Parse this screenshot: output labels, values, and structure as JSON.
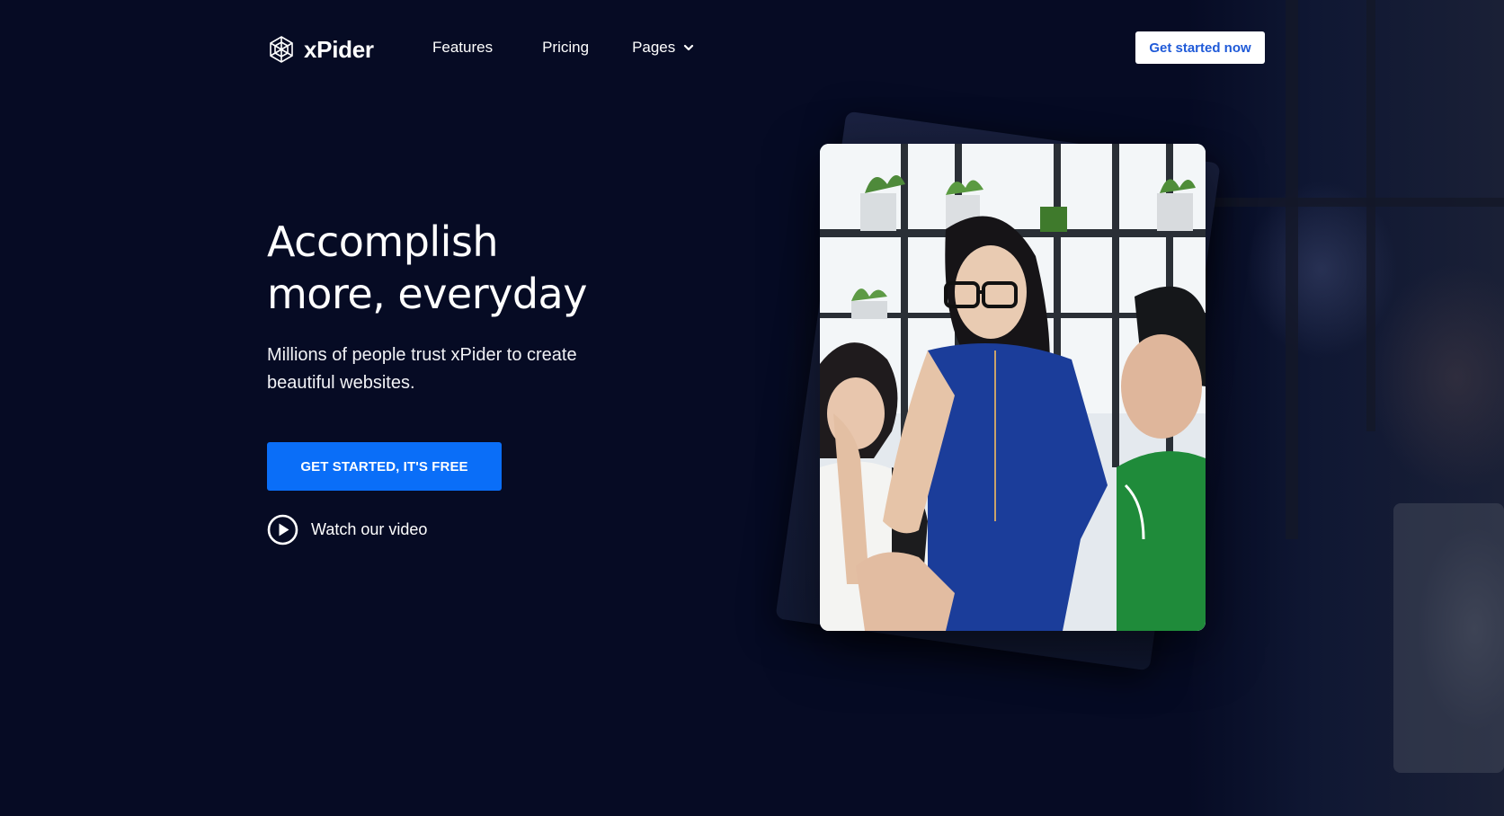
{
  "nav": {
    "logo_text": "xPider",
    "links": {
      "features": "Features",
      "pricing": "Pricing",
      "pages": "Pages"
    },
    "cta": "Get started now"
  },
  "hero": {
    "title_line1": "Accomplish",
    "title_line2": "more, everyday",
    "subtitle_line1": "Millions of people trust xPider to create",
    "subtitle_line2": "beautiful websites.",
    "cta": "GET STARTED, IT'S FREE",
    "video_link": "Watch our video"
  },
  "icons": {
    "logo": "spider-web-icon",
    "pages_dropdown": "chevron-down-icon",
    "video": "play-circle-icon"
  },
  "colors": {
    "background": "#060b24",
    "primary": "#0a6ef8",
    "cta_top_text": "#1f5ad8",
    "text": "#ffffff"
  }
}
